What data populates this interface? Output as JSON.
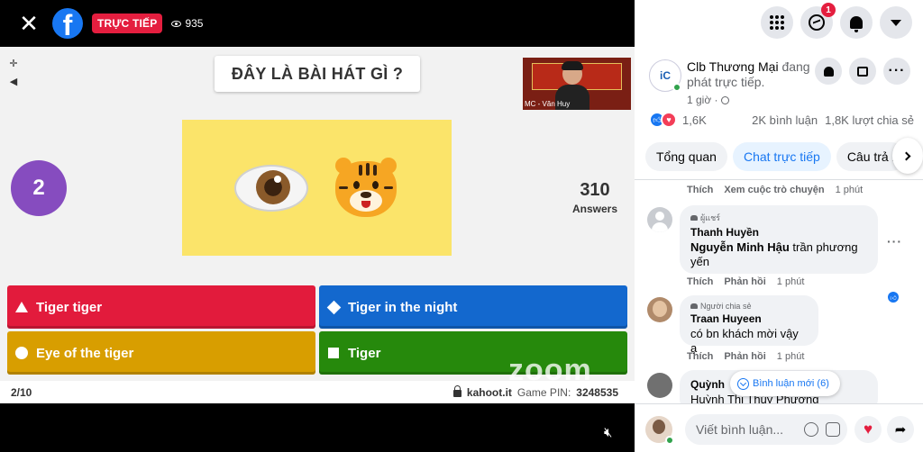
{
  "video": {
    "live_label": "TRỰC TIẾP",
    "viewer_count": "935",
    "question": "ĐÂY LÀ BÀI HÁT GÌ ?",
    "webcam_caption": "MC - Văn Huy",
    "question_number": "2",
    "answers_count": "310",
    "answers_label": "Answers",
    "options": [
      {
        "label": "Tiger tiger",
        "color": "#e21b3c",
        "shape": "triangle"
      },
      {
        "label": "Tiger in the night",
        "color": "#1368ce",
        "shape": "diamond"
      },
      {
        "label": "Eye of the tiger",
        "color": "#d89e00",
        "shape": "circle"
      },
      {
        "label": "Tiger",
        "color": "#26890c",
        "shape": "square"
      }
    ],
    "watermark": "zoom",
    "progress": "2/10",
    "site": "kahoot.it",
    "pin_label": "Game PIN:",
    "pin": "3248535"
  },
  "header": {
    "messenger_badge": "1"
  },
  "page": {
    "name": "Clb Thương Mại",
    "status": "đang phát trực tiếp.",
    "time": "1 giờ ·"
  },
  "stats": {
    "reactions": "1,6K",
    "comments": "2K bình luận",
    "shares": "1,8K lượt chia sẻ"
  },
  "tabs": [
    "Tổng quan",
    "Chat trực tiếp",
    "Câu trả l"
  ],
  "comments": {
    "top_meta": {
      "like": "Thích",
      "view": "Xem cuộc trò chuyện",
      "time": "1 phút"
    },
    "items": [
      {
        "badge": "ผู้แชร์",
        "author": "Thanh Huyền",
        "mention": "Nguyễn Minh Hậu",
        "text": " trần phương yến",
        "like": "Thích",
        "reply": "Phản hồi",
        "time": "1 phút"
      },
      {
        "badge": "Người chia sẻ",
        "author": "Traan Huyeen",
        "text": "có bn khách mời vậy ạ",
        "like": "Thích",
        "reply": "Phản hồi",
        "time": "1 phút"
      },
      {
        "author": "Quỳnh",
        "mention": "Huỳnh Thị Thúy Phương"
      }
    ],
    "new_comments": "Bình luận mới (6)"
  },
  "composer": {
    "placeholder": "Viết bình luận..."
  }
}
